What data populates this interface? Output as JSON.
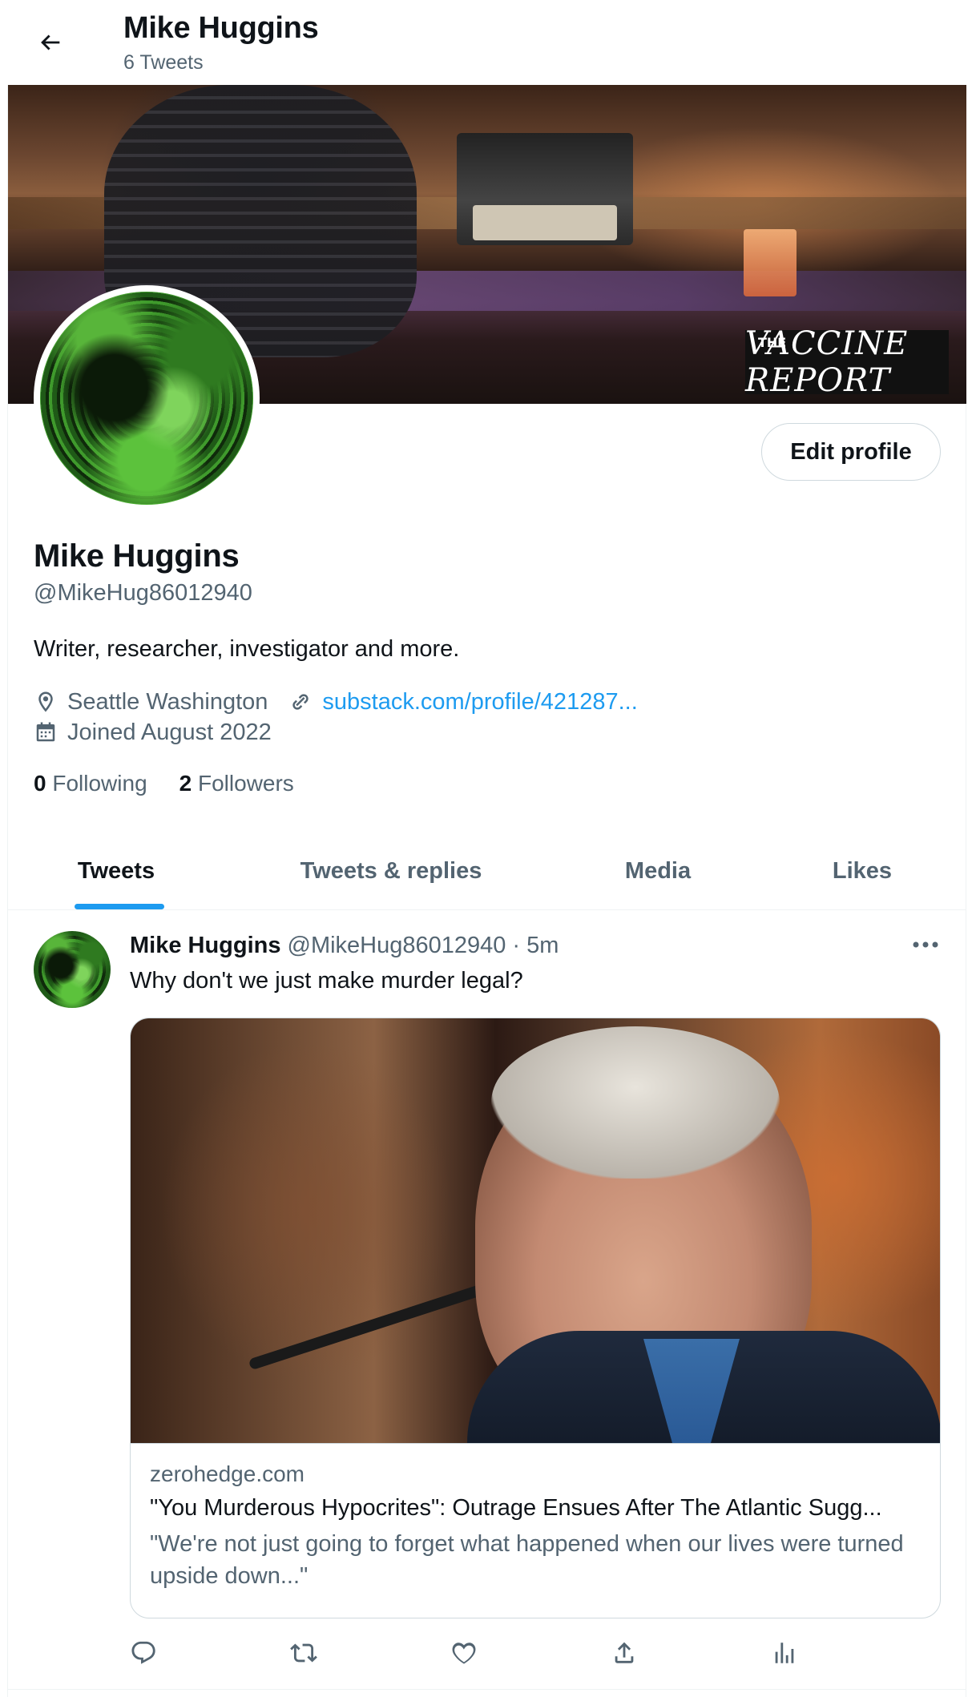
{
  "header": {
    "name": "Mike Huggins",
    "tweet_count": "6 Tweets"
  },
  "banner": {
    "badge_text": "VACCINE REPORT",
    "badge_small": "THE"
  },
  "profile": {
    "edit_button": "Edit profile",
    "name": "Mike Huggins",
    "handle": "@MikeHug86012940",
    "bio": "Writer, researcher, investigator and more.",
    "location": "Seattle Washington",
    "website": "substack.com/profile/421287...",
    "joined": "Joined August 2022",
    "following_count": "0",
    "following_label": "Following",
    "followers_count": "2",
    "followers_label": "Followers"
  },
  "tabs": [
    {
      "label": "Tweets"
    },
    {
      "label": "Tweets & replies"
    },
    {
      "label": "Media"
    },
    {
      "label": "Likes"
    }
  ],
  "tweet": {
    "author": "Mike Huggins",
    "handle": "@MikeHug86012940",
    "dot": "·",
    "time": "5m",
    "text": "Why don't we just make murder legal?",
    "card": {
      "domain": "zerohedge.com",
      "title": "\"You Murderous Hypocrites\": Outrage Ensues After The Atlantic Sugg...",
      "description": "\"We're not just going to forget what happened when our lives were turned upside down...\""
    }
  },
  "colors": {
    "accent": "#1d9bf0",
    "secondary_text": "#536471",
    "primary_text": "#0f1419"
  }
}
